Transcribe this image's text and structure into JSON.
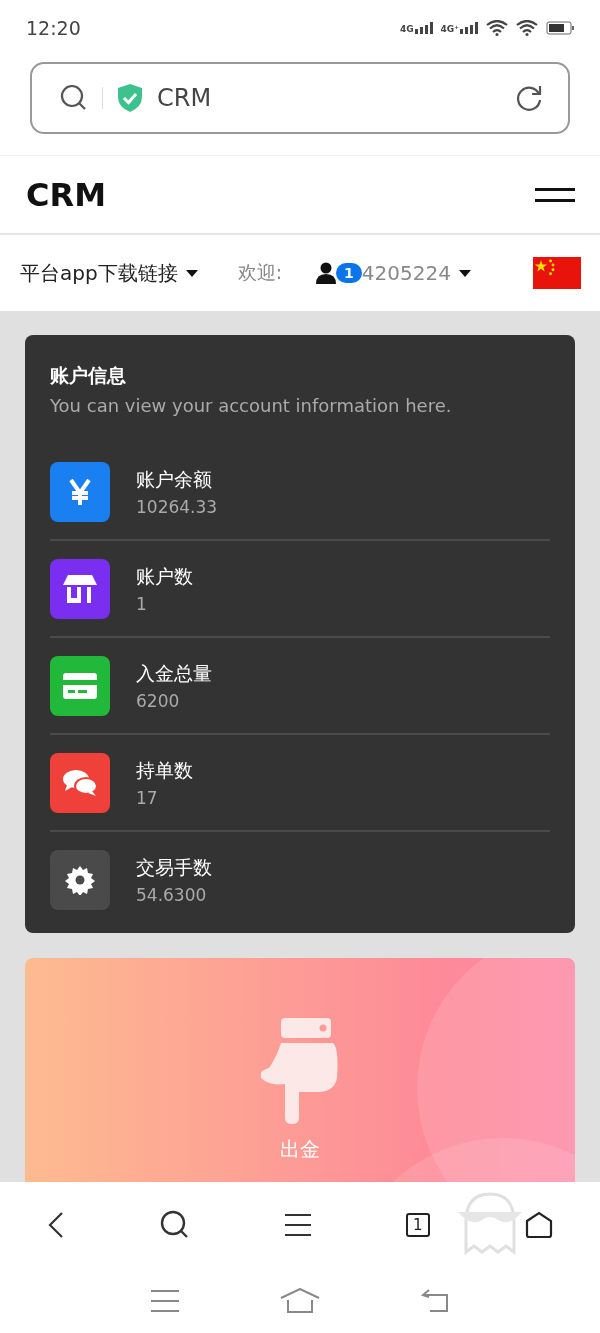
{
  "status_bar": {
    "time": "12:20",
    "signal_1": "4G",
    "signal_2": "4G⁺"
  },
  "address_bar": {
    "url": "CRM"
  },
  "header": {
    "title": "CRM"
  },
  "subnav": {
    "download_link": "平台app下载链接",
    "welcome": "欢迎:",
    "user_badge": "1",
    "user_id": "4205224"
  },
  "account_card": {
    "title": "账户信息",
    "subtitle": "You can view your account information here.",
    "items": [
      {
        "kind": "yen",
        "label": "账户余额",
        "value": "10264.33",
        "color": "#1a7ff0"
      },
      {
        "kind": "store",
        "label": "账户数",
        "value": "1",
        "color": "#7a2ff0"
      },
      {
        "kind": "card",
        "label": "入金总量",
        "value": "6200",
        "color": "#22b83a"
      },
      {
        "kind": "chat",
        "label": "持单数",
        "value": "17",
        "color": "#f0403a"
      },
      {
        "kind": "gear",
        "label": "交易手数",
        "value": "54.6300",
        "color": "#4a4a4a"
      }
    ]
  },
  "withdraw_card": {
    "label": "出金"
  },
  "browser_toolbar": {
    "tab_count": "1"
  }
}
